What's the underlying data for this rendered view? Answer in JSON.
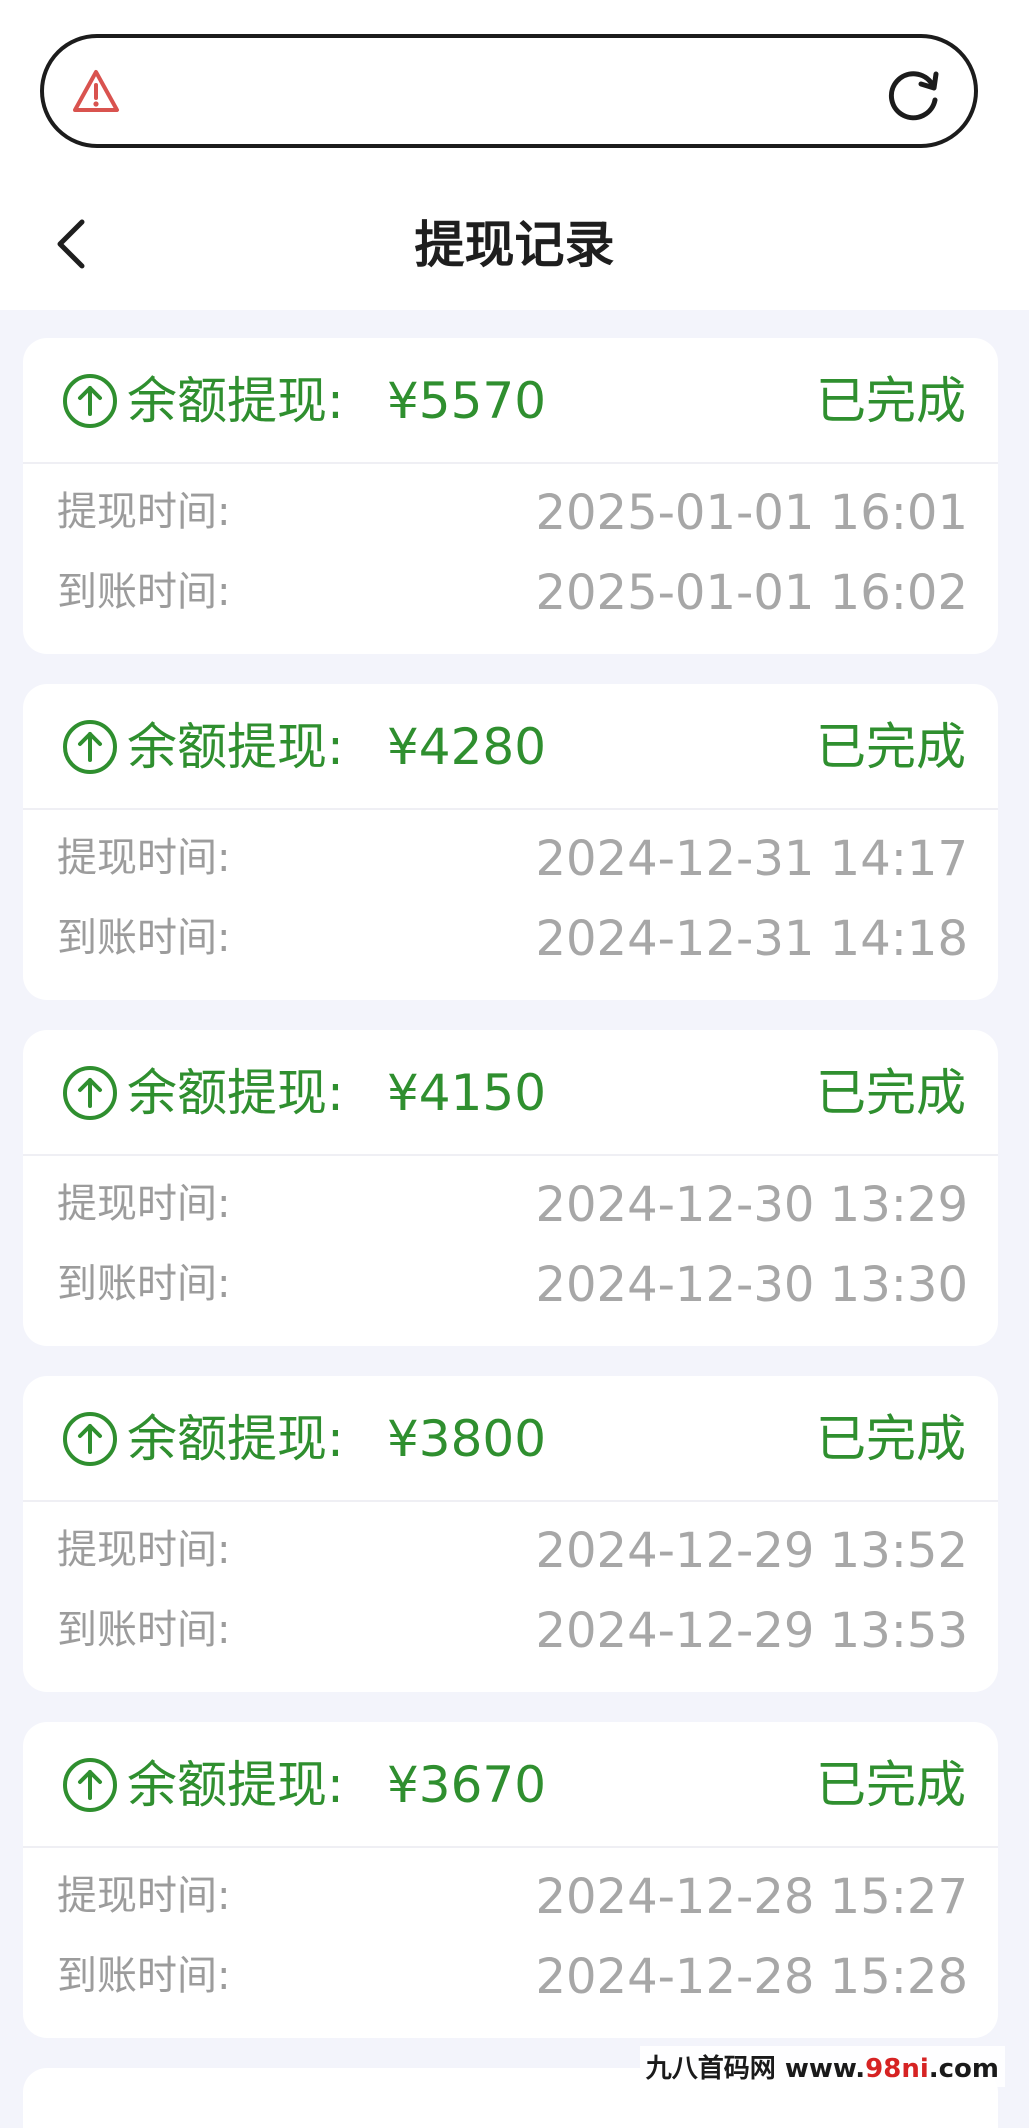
{
  "header": {
    "title": "提现记录"
  },
  "records": [
    {
      "label": "余额提现:",
      "amount": "¥5570",
      "status": "已完成",
      "withdraw_label": "提现时间:",
      "withdraw_time": "2025-01-01 16:01",
      "arrive_label": "到账时间:",
      "arrive_time": "2025-01-01 16:02"
    },
    {
      "label": "余额提现:",
      "amount": "¥4280",
      "status": "已完成",
      "withdraw_label": "提现时间:",
      "withdraw_time": "2024-12-31 14:17",
      "arrive_label": "到账时间:",
      "arrive_time": "2024-12-31 14:18"
    },
    {
      "label": "余额提现:",
      "amount": "¥4150",
      "status": "已完成",
      "withdraw_label": "提现时间:",
      "withdraw_time": "2024-12-30 13:29",
      "arrive_label": "到账时间:",
      "arrive_time": "2024-12-30 13:30"
    },
    {
      "label": "余额提现:",
      "amount": "¥3800",
      "status": "已完成",
      "withdraw_label": "提现时间:",
      "withdraw_time": "2024-12-29 13:52",
      "arrive_label": "到账时间:",
      "arrive_time": "2024-12-29 13:53"
    },
    {
      "label": "余额提现:",
      "amount": "¥3670",
      "status": "已完成",
      "withdraw_label": "提现时间:",
      "withdraw_time": "2024-12-28 15:27",
      "arrive_label": "到账时间:",
      "arrive_time": "2024-12-28 15:28"
    }
  ],
  "watermark": {
    "site_name": "九八首码网",
    "url_prefix": "www.",
    "url_highlight": "98ni",
    "url_suffix": ".com"
  },
  "icons": {
    "address_warning": "warning-triangle-icon",
    "address_reload": "reload-icon",
    "back": "chevron-left-icon",
    "record": "arrow-up-circle-icon"
  },
  "colors": {
    "accent_green": "#2f8f2f",
    "muted_text": "#a7a7a7",
    "page_background": "#f3f4fb",
    "warning_red": "#d9534f"
  }
}
